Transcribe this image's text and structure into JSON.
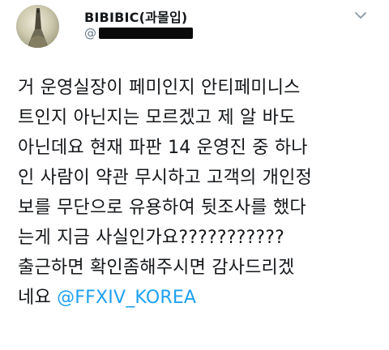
{
  "header": {
    "display_name": "BIBIBIC(과몰입)",
    "handle_prefix": "@"
  },
  "tweet": {
    "lines": [
      "거 운영실장이 페미인지 안티페미니스",
      "트인지 아닌지는 모르겠고 제 알 바도",
      "아닌데요 현재 파판 14 운영진 중 하나",
      "인 사람이 약관 무시하고 고객의 개인정",
      "보를 무단으로 유용하여 뒷조사를 했다",
      "는게 지금 사실인가요???????????",
      "출근하면 확인좀해주시면 감사드리겠"
    ],
    "last_line_text": "네요 ",
    "mention": "@FFXIV_KOREA"
  },
  "colors": {
    "mention": "#1da1f2",
    "text": "#14171a",
    "muted": "#657786"
  },
  "icons": [
    "avatar-image",
    "chevron-down-icon"
  ]
}
